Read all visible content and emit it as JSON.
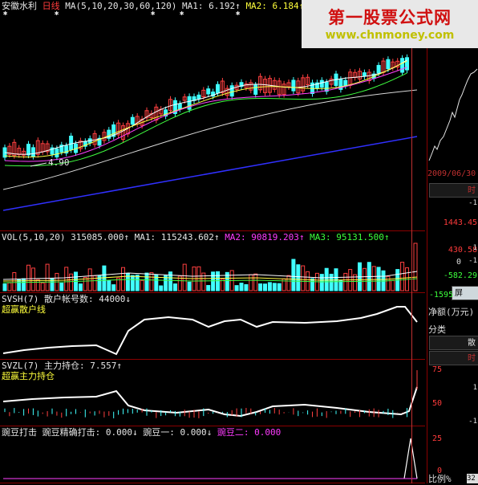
{
  "main": {
    "stock_name": "安徽水利",
    "period": "日线",
    "ma_params": "MA(5,10,20,30,60,120)",
    "ma1": "MA1: 6.192↑",
    "ma2": "MA2: 6.184↑",
    "ma_tail": "M",
    "low_price_mark": "4.90"
  },
  "vol": {
    "params": "VOL(5,10,20)",
    "value": "315085.000↑",
    "ma1": "MA1: 115243.602↑",
    "ma2": "MA2: 90819.203↑",
    "ma3": "MA3: 95131.500↑"
  },
  "svsh": {
    "line1_name": "SVSH(7)",
    "line1_label": "散户帐号数:",
    "line1_value": "44000↓",
    "line2": "超赢散户线"
  },
  "svzl": {
    "line1_name": "SVZL(7)",
    "line1_label": "主力持仓:",
    "line1_value": "7.557↑",
    "line2": "超赢主力持仓"
  },
  "wandou": {
    "name": "豌豆打击",
    "f1": "豌豆精确打击: 0.000↓",
    "f2": "豌豆一: 0.000↓",
    "f3": "豌豆二: 0.000"
  },
  "right_panel": {
    "date": "2009/06/30",
    "tab_time1": "时",
    "vol_val1": "1443.45",
    "vol_val2": "430.58",
    "vol_val3": "0",
    "vol_val4": "-582.29",
    "vol_val5": "-1595",
    "tab_ping": "屏",
    "net_label": "净额(万元)",
    "cat_label": "分类",
    "tab_san": "散",
    "tab_time2": "时",
    "y75": "75",
    "y50": "50",
    "y25": "25",
    "y0": "0",
    "ratio_label": "比例%",
    "ratio_val": "32",
    "small_pos": "1",
    "small_neg": "-1",
    "small_pos2": "1",
    "small_neg2": "-1"
  },
  "watermark": {
    "title": "第一股票公式网",
    "url": "www.chnmoney.com"
  }
}
